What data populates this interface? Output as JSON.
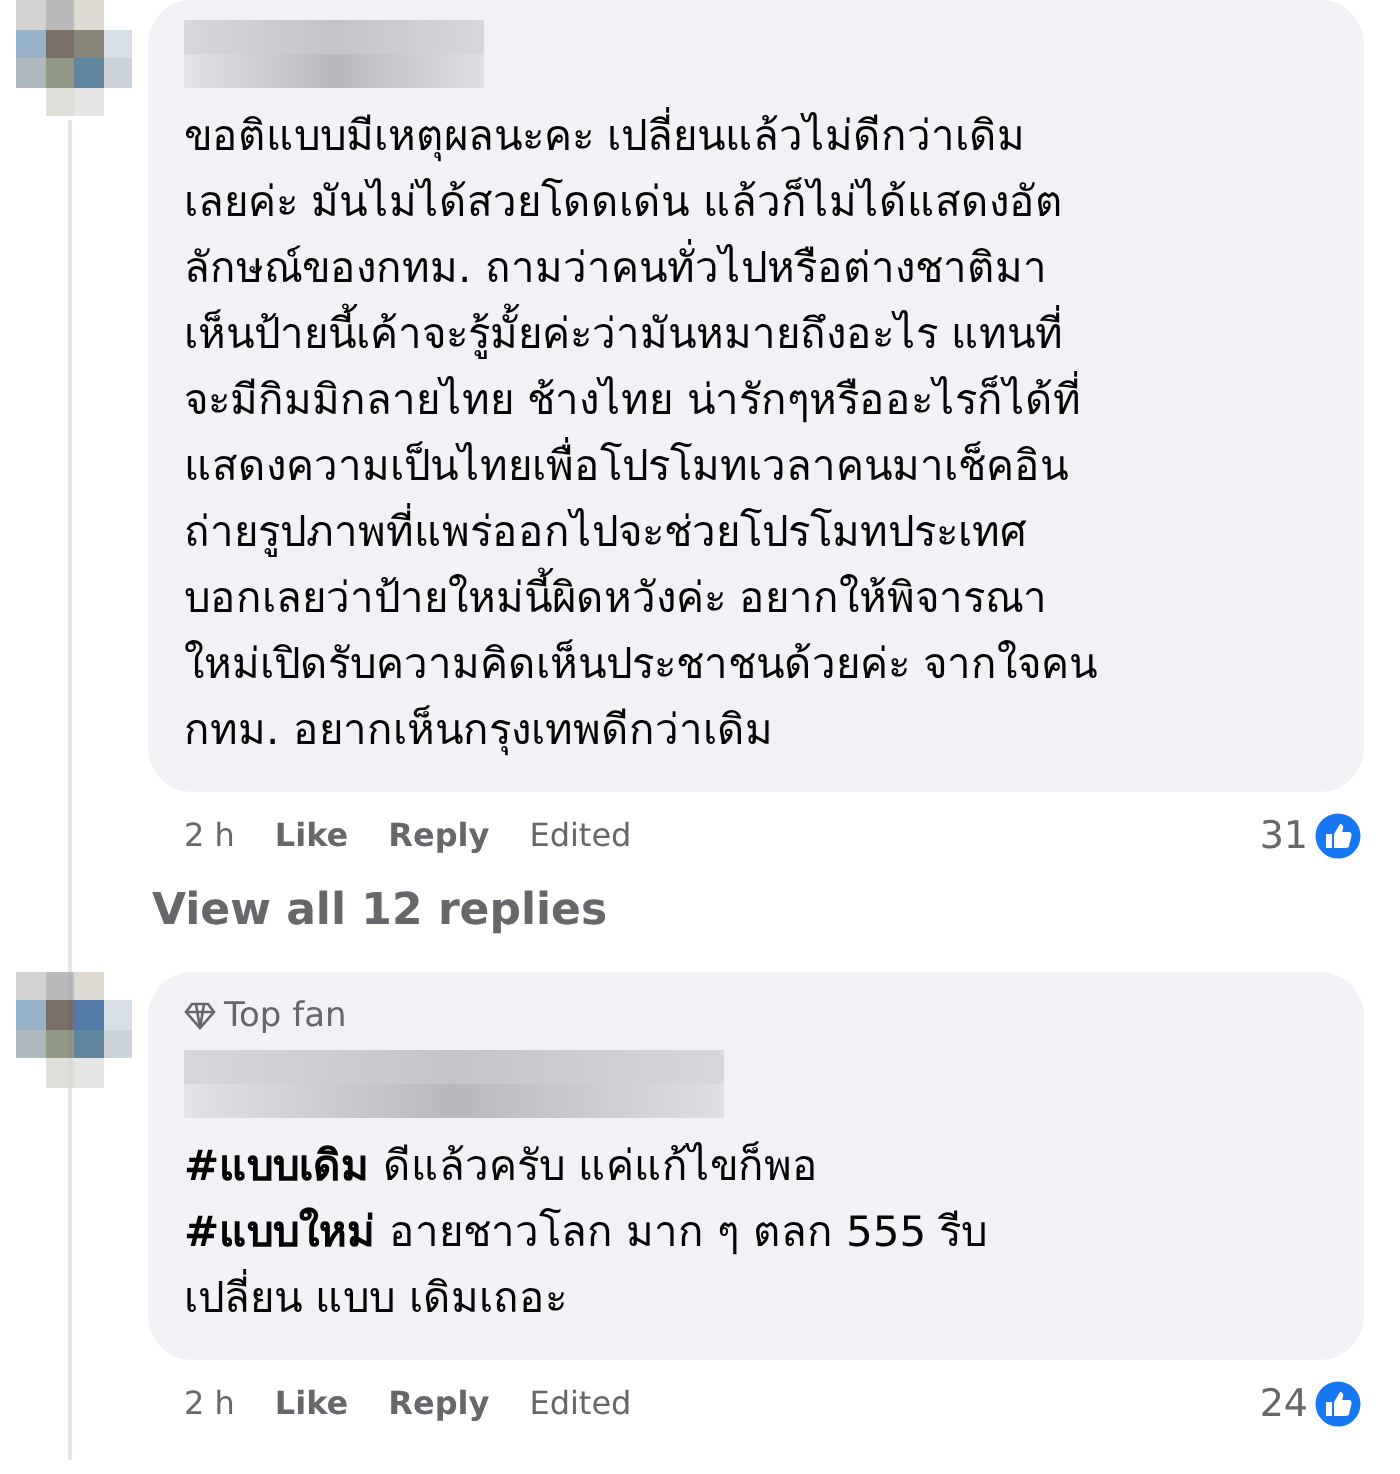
{
  "comments": [
    {
      "lines": [
        "ขอติแบบมีเหตุผลนะคะ เปลี่ยนแล้วไม่ดีกว่าเดิม",
        "เลยค่ะ มันไม่ได้สวยโดดเด่น แล้วก็ไม่ได้แสดงอัต",
        "ลักษณ์ของกทม. ถามว่าคนทั่วไปหรือต่างชาติมา",
        "เห็นป้ายนี้เค้าจะรู้มั้ยค่ะว่ามันหมายถึงอะไร แทนที่",
        "จะมีกิมมิกลายไทย ช้างไทย น่ารักๆหรืออะไรก็ได้ที่",
        "แสดงความเป็นไทยเพื่อโปรโมทเวลาคนมาเช็คอิน",
        "ถ่ายรูปภาพที่แพร่ออกไปจะช่วยโปรโมทประเทศ",
        "บอกเลยว่าป้ายใหม่นี้ผิดหวังค่ะ อยากให้พิจารณา",
        "ใหม่เปิดรับความคิดเห็นประชาชนด้วยค่ะ จากใจคน",
        "กทม. อยากเห็นกรุงเทพดีกว่าเดิม"
      ],
      "time": "2 h",
      "like": "Like",
      "reply": "Reply",
      "edited": "Edited",
      "reactions": "31"
    },
    {
      "badge": "Top fan",
      "lines": [
        "**#แบบเดิม** ดีแล้วครับ แค่แก้ไขก็พอ",
        "**#แบบใหม่** อายชาวโลก มาก ๆ ตลก 555 รีบ",
        "เปลี่ยน แบบ เดิมเถอะ"
      ],
      "time": "2 h",
      "like": "Like",
      "reply": "Reply",
      "edited": "Edited",
      "reactions": "24"
    }
  ],
  "view_replies": "View all 12 replies"
}
